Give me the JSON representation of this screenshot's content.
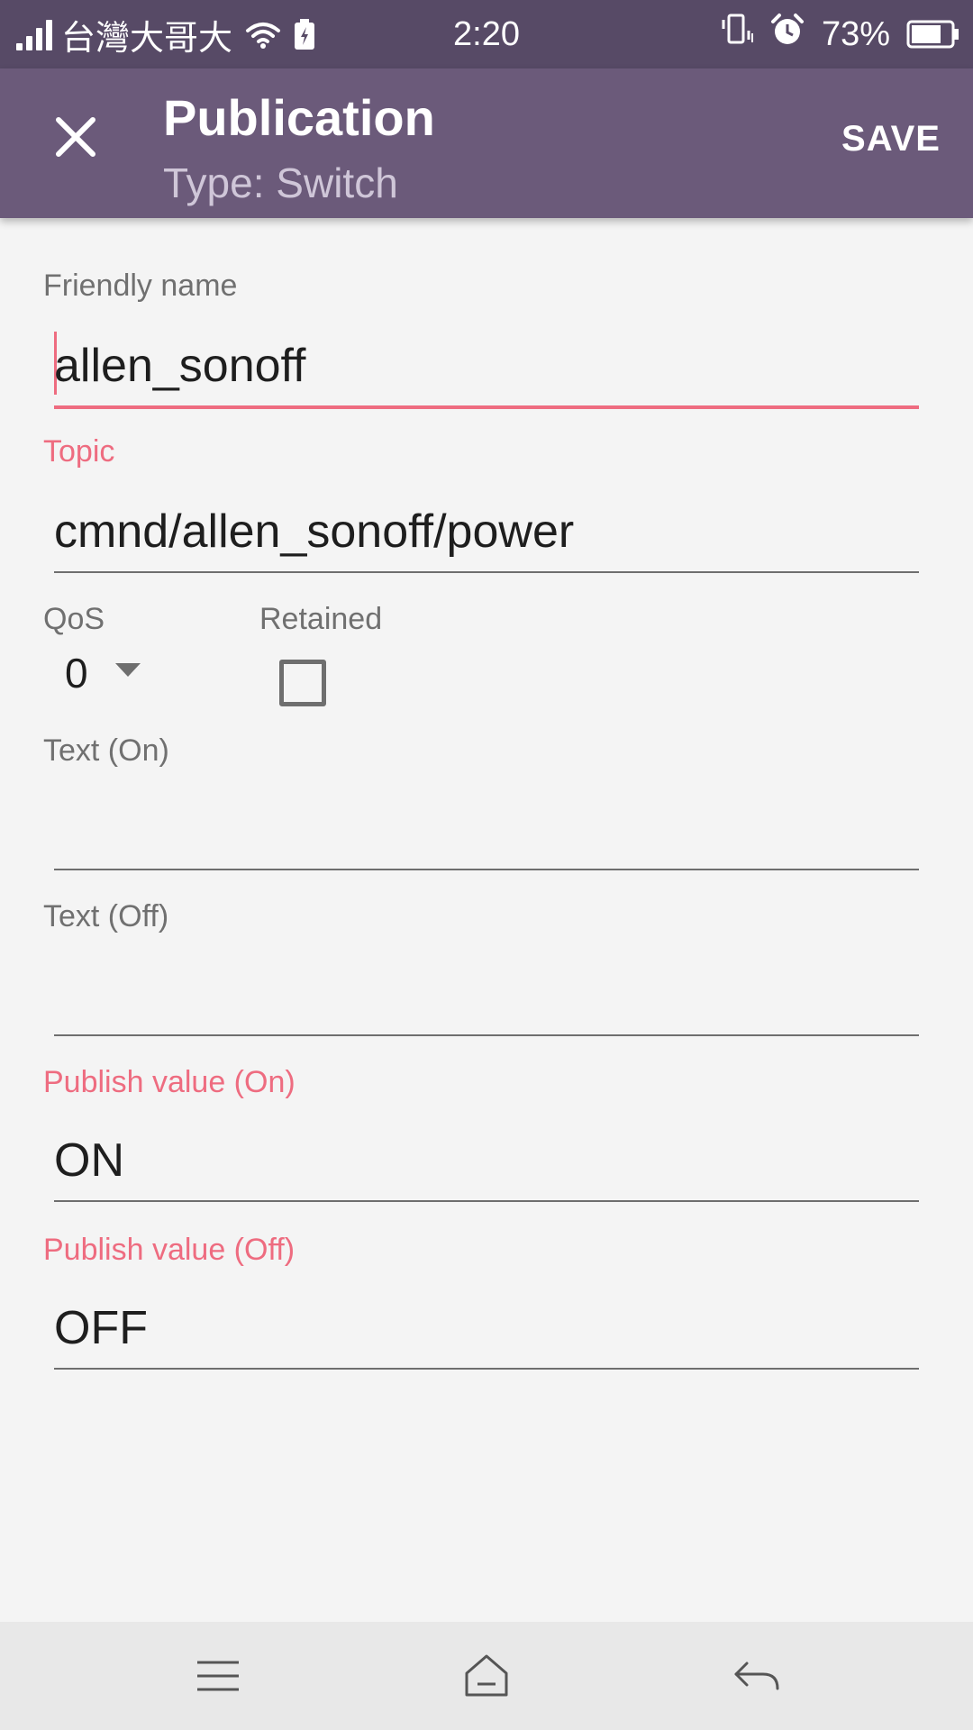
{
  "status_bar": {
    "carrier": "台灣大哥大",
    "time": "2:20",
    "battery": "73%",
    "icons": [
      "signal-icon",
      "wifi-icon",
      "charging-icon",
      "vibrate-icon",
      "alarm-icon",
      "battery-icon"
    ]
  },
  "app_bar": {
    "title": "Publication",
    "subtitle": "Type: Switch",
    "save_label": "SAVE",
    "close_icon": "close-icon",
    "color": "#6b5a7a"
  },
  "form": {
    "friendly_name": {
      "label": "Friendly name",
      "value": "allen_sonoff"
    },
    "topic": {
      "label": "Topic",
      "value": "cmnd/allen_sonoff/power"
    },
    "qos": {
      "label": "QoS",
      "value": "0"
    },
    "retained": {
      "label": "Retained",
      "checked": false
    },
    "text_on": {
      "label": "Text (On)",
      "value": ""
    },
    "text_off": {
      "label": "Text (Off)",
      "value": ""
    },
    "publish_on": {
      "label": "Publish value (On)",
      "value": "ON"
    },
    "publish_off": {
      "label": "Publish value (Off)",
      "value": "OFF"
    }
  },
  "colors": {
    "accent": "#ee6c80",
    "status_bar": "#574a66",
    "background": "#f4f4f4"
  },
  "nav_bar": {
    "icons": [
      "menu-icon",
      "home-icon",
      "back-icon"
    ]
  }
}
